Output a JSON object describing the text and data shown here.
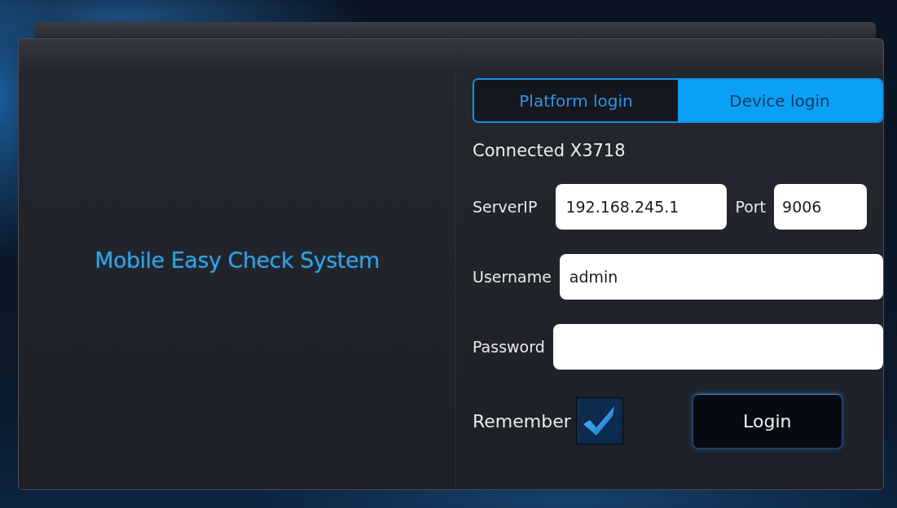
{
  "app_title": "Mobile Easy Check System",
  "tabs": [
    {
      "label": "Platform login",
      "selected": false
    },
    {
      "label": "Device login",
      "selected": true
    }
  ],
  "status": "Connected X3718",
  "server": {
    "label": "ServerIP",
    "value": "192.168.245.1"
  },
  "port": {
    "label": "Port",
    "value": "9006"
  },
  "username": {
    "label": "Username",
    "value": "admin"
  },
  "password": {
    "label": "Password"
  },
  "remember": {
    "label": "Remember",
    "checked": true
  },
  "login_button": "Login"
}
